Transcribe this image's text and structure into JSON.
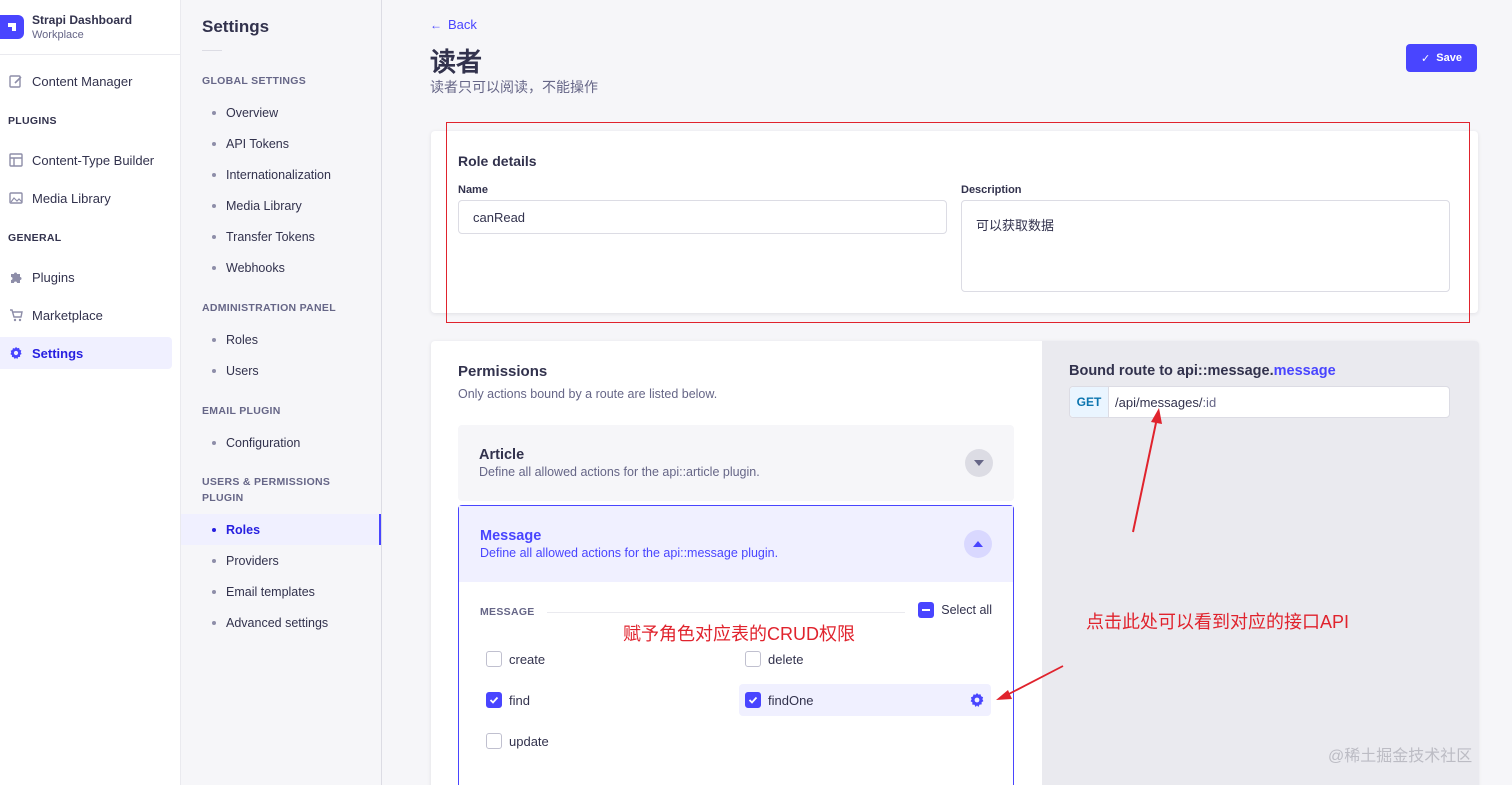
{
  "brand": {
    "title": "Strapi Dashboard",
    "subtitle": "Workplace"
  },
  "leftnav": {
    "content_manager": "Content Manager",
    "plugins_section": "PLUGINS",
    "content_type_builder": "Content-Type Builder",
    "media_library": "Media Library",
    "general_section": "GENERAL",
    "plugins": "Plugins",
    "marketplace": "Marketplace",
    "settings": "Settings"
  },
  "subnav": {
    "title": "Settings",
    "global_section": "GLOBAL SETTINGS",
    "global_items": [
      "Overview",
      "API Tokens",
      "Internationalization",
      "Media Library",
      "Transfer Tokens",
      "Webhooks"
    ],
    "admin_section": "ADMINISTRATION PANEL",
    "admin_items": [
      "Roles",
      "Users"
    ],
    "email_section": "EMAIL PLUGIN",
    "email_items": [
      "Configuration"
    ],
    "users_section": "USERS & PERMISSIONS PLUGIN",
    "users_items": [
      "Roles",
      "Providers",
      "Email templates",
      "Advanced settings"
    ]
  },
  "header": {
    "back": "Back",
    "title": "读者",
    "subtitle": "读者只可以阅读，不能操作",
    "save": "Save"
  },
  "role_details": {
    "heading": "Role details",
    "name_label": "Name",
    "name_value": "canRead",
    "description_label": "Description",
    "description_value": "可以获取数据"
  },
  "permissions": {
    "heading": "Permissions",
    "subtitle": "Only actions bound by a route are listed below.",
    "article": {
      "title": "Article",
      "desc": "Define all allowed actions for the api::article plugin."
    },
    "message": {
      "title": "Message",
      "desc": "Define all allowed actions for the api::message plugin."
    },
    "group_label": "MESSAGE",
    "select_all": "Select all",
    "actions": {
      "create": {
        "label": "create",
        "checked": false
      },
      "delete": {
        "label": "delete",
        "checked": false
      },
      "find": {
        "label": "find",
        "checked": true
      },
      "findOne": {
        "label": "findOne",
        "checked": true
      },
      "update": {
        "label": "update",
        "checked": false
      }
    }
  },
  "route": {
    "title_prefix": "Bound route to api::message.",
    "title_highlight": "message",
    "verb": "GET",
    "path": "/api/messages/",
    "param": ":id"
  },
  "annotations": {
    "crud": "赋予角色对应表的CRUD权限",
    "api": "点击此处可以看到对应的接口API"
  },
  "watermark": "@稀土掘金技术社区",
  "colors": {
    "primary": "#4945ff",
    "annotation_red": "#e0232d"
  }
}
